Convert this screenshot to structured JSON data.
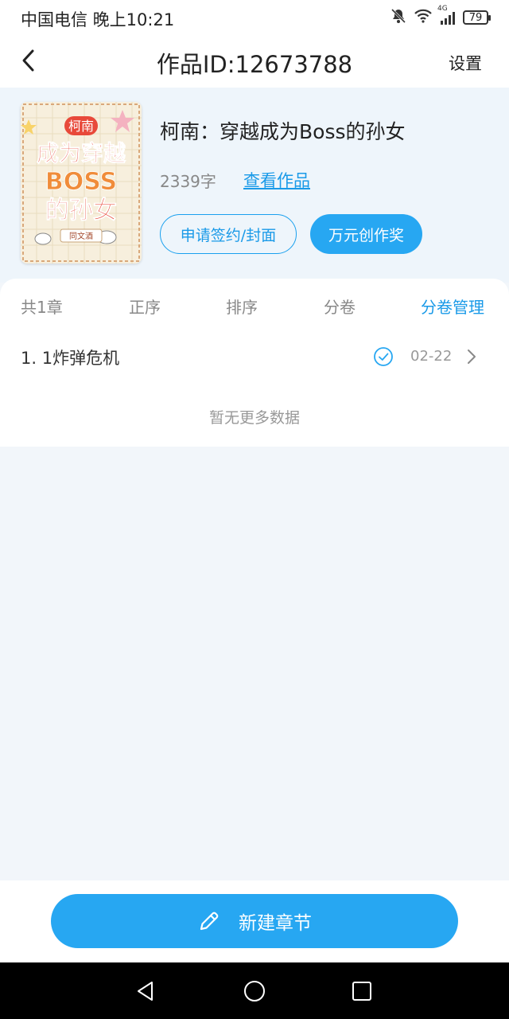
{
  "status_bar": {
    "carrier_time": "中国电信 晚上10:21",
    "network": "4G",
    "battery": "79"
  },
  "nav": {
    "title": "作品ID:12673788",
    "settings": "设置"
  },
  "work": {
    "title": "柯南：穿越成为Boss的孙女",
    "word_count": "2339字",
    "view_link": "查看作品",
    "sign_button": "申请签约/封面",
    "award_button": "万元创作奖",
    "cover": {
      "tag": "柯南",
      "line1": "成为穿越",
      "line2": "BOSS",
      "line3": "的孙女",
      "author": "同文酒"
    }
  },
  "chapters": {
    "toolbar": {
      "count": "共1章",
      "order": "正序",
      "sort": "排序",
      "volume": "分卷",
      "volume_manage": "分卷管理"
    },
    "items": [
      {
        "title": "1. 1炸弹危机",
        "date": "02-22"
      }
    ],
    "empty_text": "暂无更多数据"
  },
  "bottom": {
    "new_chapter": "新建章节"
  },
  "colors": {
    "accent": "#27a7f2",
    "link": "#1a9ae8",
    "page_bg": "#f2f6fa"
  }
}
